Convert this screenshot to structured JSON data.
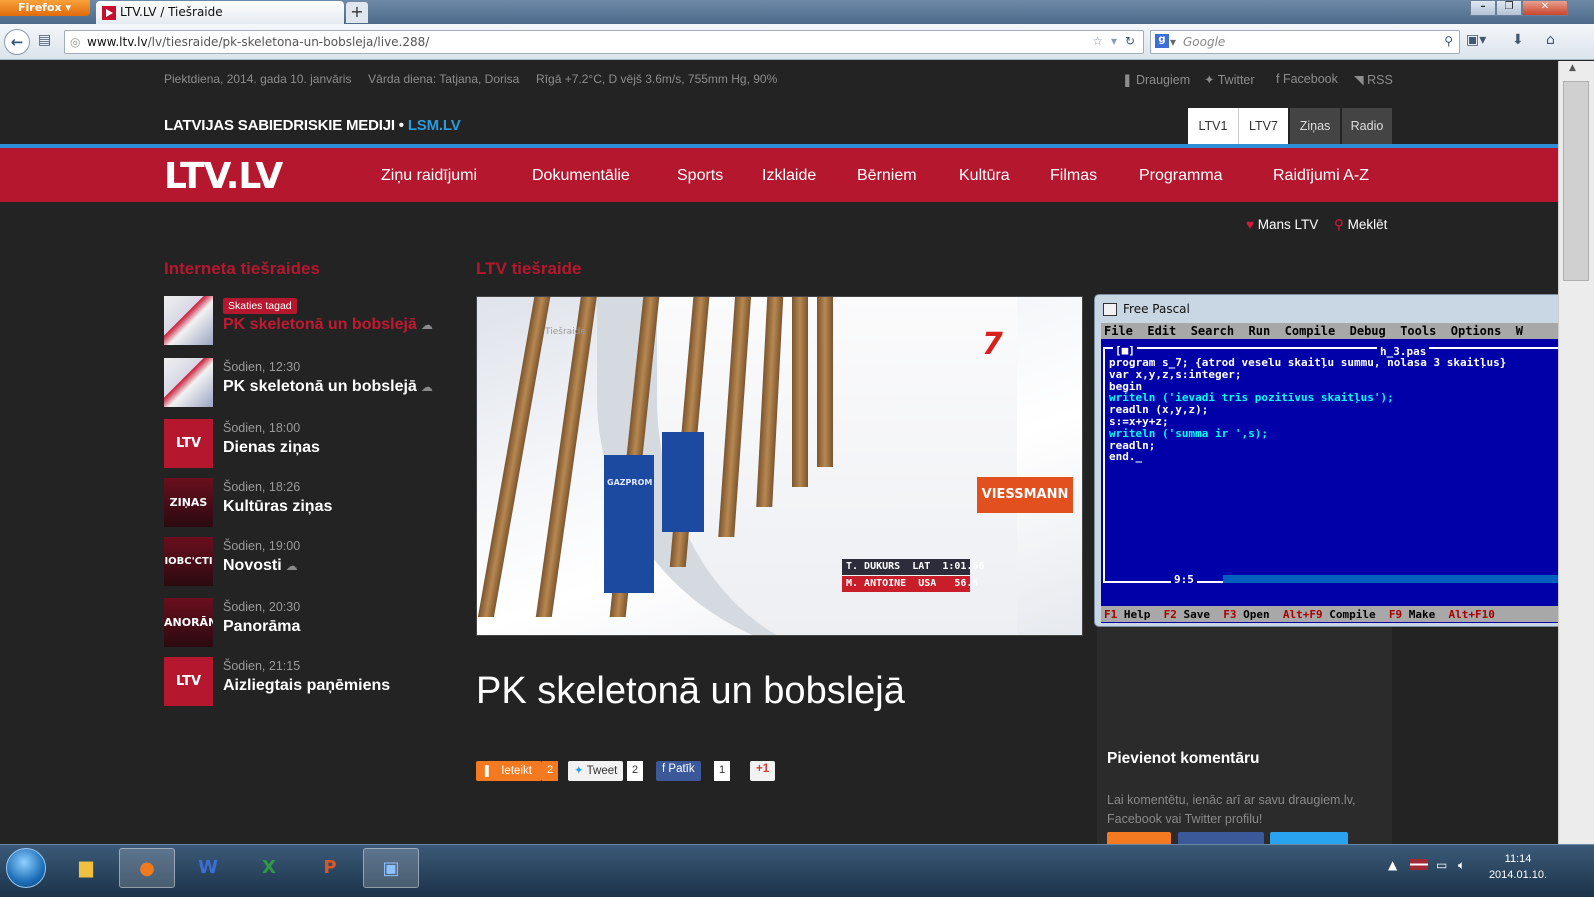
{
  "browser": {
    "firefox_label": "Firefox",
    "tab_title": "LTV.LV / Tiešraide",
    "new_tab": "+",
    "url_host": "www.ltv.lv",
    "url_path": "/lv/tiesraide/pk-skeletona-un-bobsleja/live.288/",
    "search_placeholder": "Google"
  },
  "site": {
    "date_line": "Piektdiena, 2014. gada 10. janvāris",
    "name_day": "Vārda diena: Tatjana, Dorisa",
    "weather": "Rīgā +7.2°C, D vējš 3.6m/s, 755mm Hg, 90%",
    "social": [
      "Draugiem",
      "Twitter",
      "Facebook",
      "RSS"
    ],
    "lsm_text": "LATVIJAS SABIEDRISKIE MEDIJI •",
    "lsm_link": "LSM.LV",
    "channel_tabs": [
      "LTV1",
      "LTV7",
      "Ziņas",
      "Radio"
    ],
    "logo": "LTV.LV",
    "nav": [
      "Ziņu raidījumi",
      "Dokumentālie",
      "Sports",
      "Izklaide",
      "Bērniem",
      "Kultūra",
      "Filmas",
      "Programma",
      "Raidījumi A-Z"
    ],
    "mans_ltv": "Mans LTV",
    "search": "Meklēt"
  },
  "sidebar": {
    "title": "Interneta tiešraides",
    "badge": "Skaties tagad",
    "items": [
      {
        "time": "",
        "title": "PK skeletonā un bobslejā",
        "thumb": ""
      },
      {
        "time": "Šodien, 12:30",
        "title": "PK skeletonā un bobslejā",
        "thumb": ""
      },
      {
        "time": "Šodien, 18:00",
        "title": "Dienas ziņas",
        "thumb": "LTV"
      },
      {
        "time": "Šodien, 18:26",
        "title": "Kultūras ziņas",
        "thumb": "ZIŅAS"
      },
      {
        "time": "Šodien, 19:00",
        "title": "Novosti",
        "thumb": "IOBC'CTI"
      },
      {
        "time": "Šodien, 20:30",
        "title": "Panorāma",
        "thumb": "ANORĀN"
      },
      {
        "time": "Šodien, 21:15",
        "title": "Aizliegtais paņēmiens",
        "thumb": "LTV"
      }
    ]
  },
  "main": {
    "title": "LTV tiešraide",
    "video": {
      "overlay_label": "Tiešraide",
      "sponsor1": "GAZPROM",
      "sponsor2": "VIESSMANN",
      "channel": "7",
      "score": [
        "T. DUKURS  LAT  1:01.66",
        "M. ANTOINE  USA   56.5"
      ]
    },
    "headline": "PK skeletonā un bobslejā",
    "share": {
      "draugiem": "Ieteikt",
      "draugiem_count": "2",
      "tweet": "Tweet",
      "tweet_count": "2",
      "like": "Patīk",
      "like_count": "1",
      "gplus": "+1"
    }
  },
  "comments": {
    "title": "Pievienot komentāru",
    "text": "Lai komentētu, ienāc arī ar savu draugiem.lv, Facebook vai Twitter profilu!"
  },
  "pascal": {
    "window_title": "Free Pascal",
    "menu": "File  Edit  Search  Run  Compile  Debug  Tools  Options  W",
    "file_name": "h_3.pas",
    "frame_marker": "[■]",
    "code": [
      "program s_7; {atrod veselu skaitļu summu, nolasa 3 skaitļus}",
      "var x,y,z,s:integer;",
      "begin",
      "writeln ('ievadi trīs pozitīvus skaitļus');",
      "readln (x,y,z);",
      "s:=x+y+z;",
      "writeln ('summa ir ',s);",
      "readln;",
      "end._"
    ],
    "cursor_pos": "9:5",
    "status": [
      "F1",
      "Help",
      "F2",
      "Save",
      "F3",
      "Open",
      "Alt+F9",
      "Compile",
      "F9",
      "Make",
      "Alt+F10"
    ]
  },
  "taskbar": {
    "clock_time": "11:14",
    "clock_date": "2014.01.10."
  },
  "colors": {
    "ltv_red": "#b5172f",
    "lsm_blue": "#2b9bde",
    "pascal_blue": "#0000a8"
  }
}
